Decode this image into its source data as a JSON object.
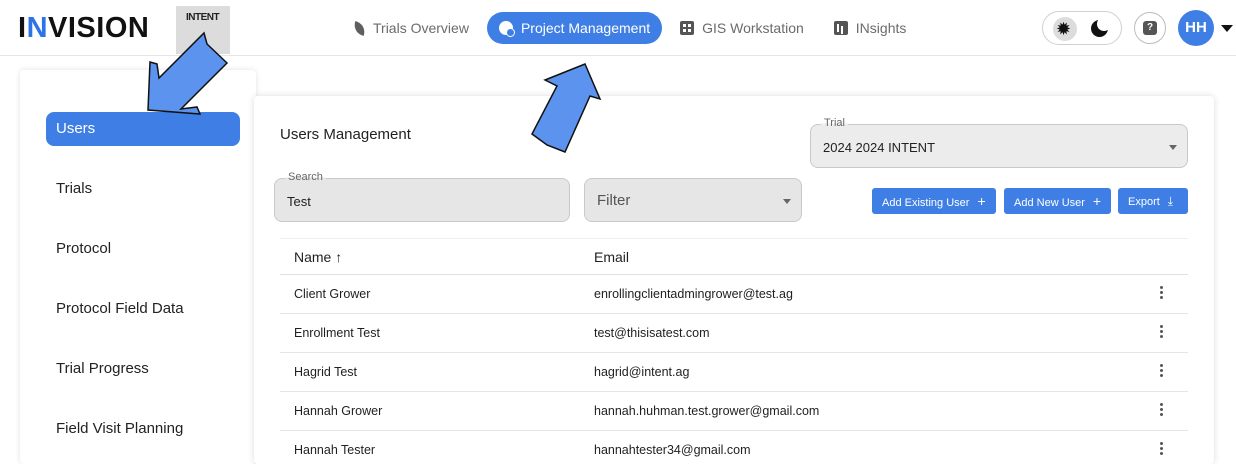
{
  "app": {
    "logo_prefix": "I",
    "logo_accent": "N",
    "logo_rest": "VISION",
    "brand_badge": "INTENT"
  },
  "nav": [
    {
      "label": "Trials Overview",
      "icon": "leaf-icon",
      "active": false
    },
    {
      "label": "Project Management",
      "icon": "project-icon",
      "active": true
    },
    {
      "label": "GIS Workstation",
      "icon": "grid-icon",
      "active": false
    },
    {
      "label": "INsights",
      "icon": "insights-icon",
      "active": false
    }
  ],
  "header": {
    "help_glyph": "?",
    "avatar_initials": "HH"
  },
  "sidebar": {
    "items": [
      {
        "label": "Users",
        "active": true
      },
      {
        "label": "Trials"
      },
      {
        "label": "Protocol"
      },
      {
        "label": "Protocol Field Data"
      },
      {
        "label": "Trial Progress"
      },
      {
        "label": "Field Visit Planning"
      }
    ]
  },
  "main": {
    "title": "Users Management",
    "trial": {
      "label": "Trial",
      "value": "2024 2024 INTENT"
    },
    "search": {
      "label": "Search",
      "value": "Test"
    },
    "filter": {
      "placeholder": "Filter"
    },
    "buttons": {
      "add_existing": "Add Existing User",
      "add_new": "Add New User",
      "export": "Export"
    },
    "table": {
      "columns": [
        "Name ↑",
        "Email"
      ],
      "rows": [
        {
          "name": "Client Grower",
          "email": "enrollingclientadmingrower@test.ag"
        },
        {
          "name": "Enrollment Test",
          "email": "test@thisisatest.com"
        },
        {
          "name": "Hagrid Test",
          "email": "hagrid@intent.ag"
        },
        {
          "name": "Hannah Grower",
          "email": "hannah.huhman.test.grower@gmail.com"
        },
        {
          "name": "Hannah Tester",
          "email": "hannahtester34@gmail.com"
        }
      ]
    }
  },
  "colors": {
    "accent": "#3f7fe5",
    "annotation_arrow": "#5b93ee"
  }
}
